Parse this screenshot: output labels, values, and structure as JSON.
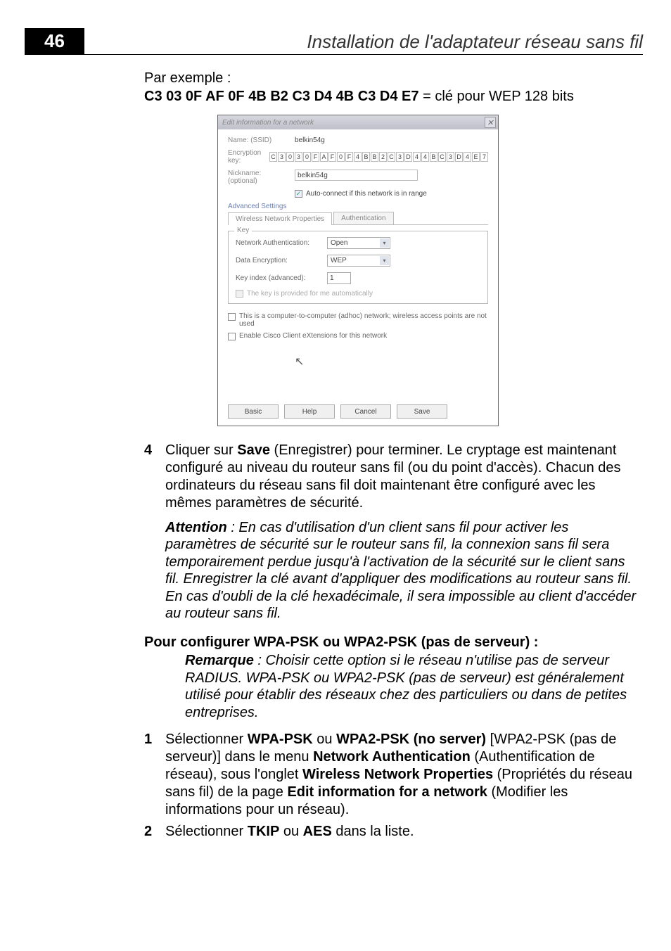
{
  "page_number": "46",
  "header_title": "Installation de l'adaptateur réseau sans fil",
  "example_label": "Par exemple :",
  "key_bold": "C3 03 0F AF 0F 4B B2 C3 D4 4B C3 D4 E7",
  "key_rest": " = clé pour WEP 128 bits",
  "dialog": {
    "title": "Edit information for a network",
    "name_label": "Name: (SSID)",
    "name_value": "belkin54g",
    "enc_label": "Encryption key:",
    "enc_chars": [
      "C",
      "3",
      "0",
      "3",
      "0",
      "F",
      "A",
      "F",
      "0",
      "F",
      "4",
      "B",
      "B",
      "2",
      "C",
      "3",
      "D",
      "4",
      "4",
      "B",
      "C",
      "3",
      "D",
      "4",
      "E",
      "7"
    ],
    "nickname_label": "Nickname:",
    "nickname_optional": "(optional)",
    "nickname_value": "belkin54g",
    "autoconnect": "Auto-connect if this network is in range",
    "adv_settings": "Advanced Settings",
    "tab1": "Wireless Network Properties",
    "tab2": "Authentication",
    "key_group": "Key",
    "netauth_label": "Network Authentication:",
    "netauth_value": "Open",
    "dataenc_label": "Data Encryption:",
    "dataenc_value": "WEP",
    "keyidx_label": "Key index (advanced):",
    "keyidx_value": "1",
    "auto_key": "The key is provided for me automatically",
    "adhoc": "This is a computer-to-computer (adhoc) network; wireless access points are not used",
    "cisco": "Enable Cisco Client eXtensions for this network",
    "btn_basic": "Basic",
    "btn_help": "Help",
    "btn_cancel": "Cancel",
    "btn_save": "Save"
  },
  "step4": {
    "num": "4",
    "text_before": "Cliquer sur ",
    "save_bold": "Save",
    "text_after": " (Enregistrer) pour terminer. Le cryptage est maintenant configuré au niveau du routeur sans fil (ou du point d'accès). Chacun des ordinateurs du réseau sans fil doit maintenant être configuré avec les mêmes paramètres de sécurité."
  },
  "attention": {
    "label": "Attention",
    "text": " : En cas d'utilisation d'un client sans fil pour activer les paramètres de sécurité sur le routeur sans fil, la connexion sans fil sera temporairement perdue jusqu'à l'activation de la sécurité sur le client sans fil. Enregistrer la clé avant d'appliquer des modifications au routeur sans fil. En cas d'oubli de la clé hexadécimale, il sera impossible au client d'accéder au routeur sans fil."
  },
  "subhead": "Pour configurer WPA-PSK ou WPA2-PSK (pas de serveur) :",
  "remarque": {
    "label": "Remarque",
    "text": " : Choisir cette option si le réseau n'utilise pas de serveur RADIUS. WPA-PSK ou WPA2-PSK (pas de serveur) est généralement utilisé pour établir des réseaux chez des particuliers ou dans de petites entreprises."
  },
  "step1": {
    "num": "1",
    "p1": "Sélectionner ",
    "b1": "WPA-PSK",
    "p2": " ou ",
    "b2": "WPA2-PSK (no server)",
    "p3": " [WPA2-PSK (pas de serveur)] dans le menu ",
    "b3": "Network Authentication",
    "p4": " (Authentification de réseau), sous l'onglet ",
    "b4": "Wireless Network Properties",
    "p5": " (Propriétés du réseau sans fil) de la page ",
    "b5": "Edit information for a network",
    "p6": " (Modifier les informations pour un réseau)."
  },
  "step2": {
    "num": "2",
    "p1": "Sélectionner ",
    "b1": "TKIP",
    "p2": " ou ",
    "b2": "AES",
    "p3": " dans la liste."
  }
}
